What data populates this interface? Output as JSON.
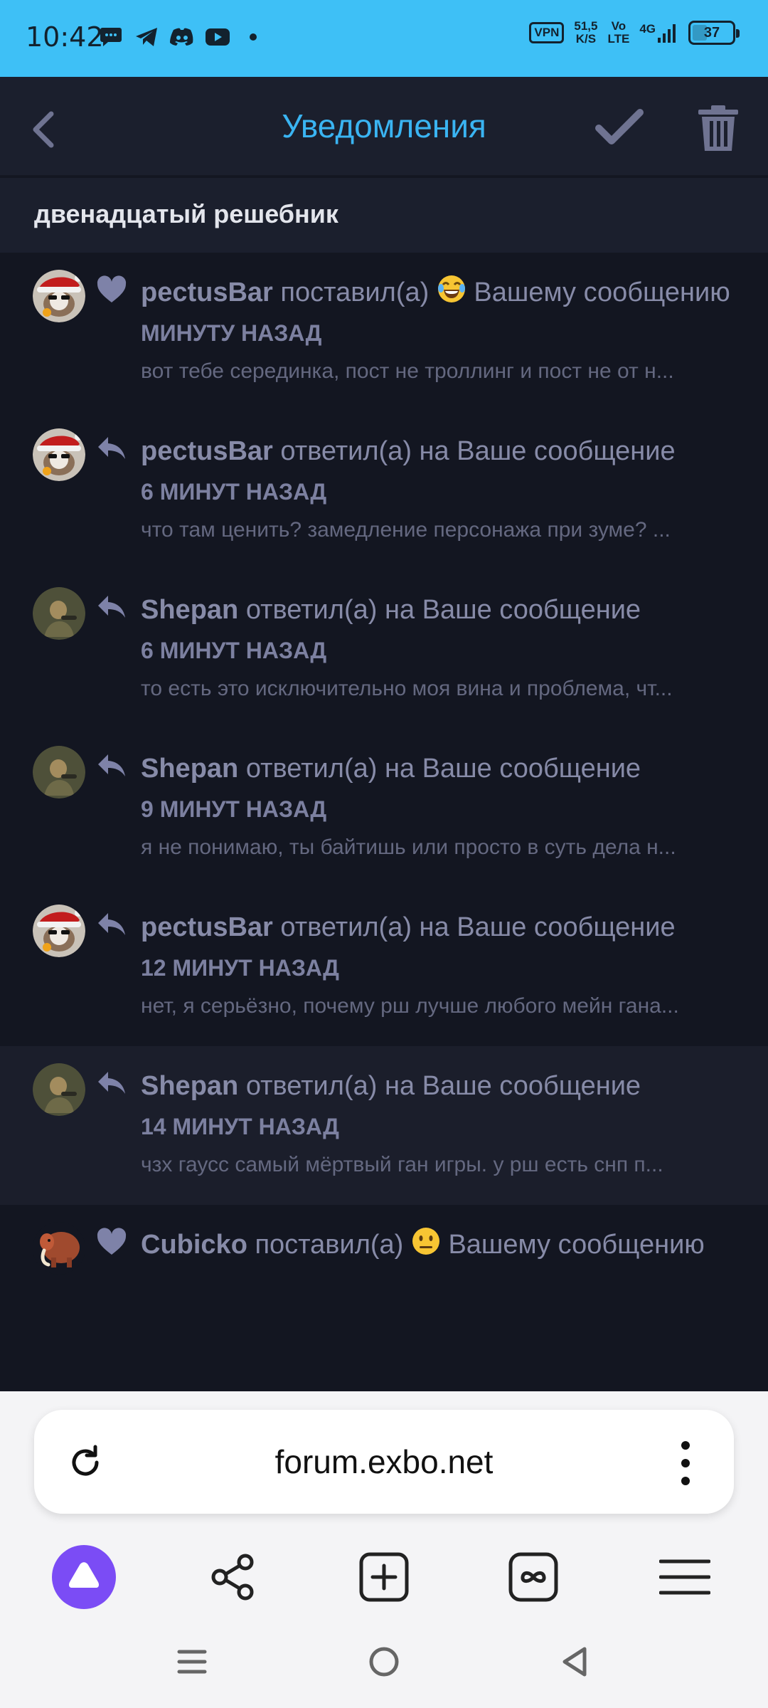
{
  "status_bar": {
    "time": "10:42",
    "vpn": "VPN",
    "net_speed_top": "51,5",
    "net_speed_bottom": "K/S",
    "volte_top": "Vo",
    "volte_bottom": "LTE",
    "network": "4G",
    "battery": "37",
    "icons": [
      "chat-bubble-icon",
      "telegram-icon",
      "discord-icon",
      "youtube-icon",
      "dot-icon"
    ]
  },
  "header": {
    "title": "Уведомления",
    "back_icon": "chevron-left-icon",
    "mark_read_icon": "checkmark-icon",
    "delete_icon": "trash-icon",
    "accent": "#3ab4f2"
  },
  "section": {
    "title": "двенадцатый решебник"
  },
  "notifications": [
    {
      "user": "pectusBar",
      "action": "поставил(а)",
      "emoji": "😂",
      "rest": "Вашему сообщению",
      "time": "МИНУТУ НАЗАД",
      "excerpt": "вот тебе серединка, пост не троллинг и пост не от н...",
      "type_icon": "heart-icon",
      "avatar": "santa-hat-avatar"
    },
    {
      "user": "pectusBar",
      "action": "ответил(а) на Ваше сообщение",
      "time": "6 МИНУТ НАЗАД",
      "excerpt": "что там ценить? замедление персонажа при зуме? ...",
      "type_icon": "reply-icon",
      "avatar": "santa-hat-avatar"
    },
    {
      "user": "Shepan",
      "action": "ответил(а) на Ваше сообщение",
      "time": "6 МИНУТ НАЗАД",
      "excerpt": "то есть это исключительно моя вина и проблема, чт...",
      "type_icon": "reply-icon",
      "avatar": "soldier-avatar"
    },
    {
      "user": "Shepan",
      "action": "ответил(а) на Ваше сообщение",
      "time": "9 МИНУТ НАЗАД",
      "excerpt": "я не понимаю, ты байтишь или просто в суть дела н...",
      "type_icon": "reply-icon",
      "avatar": "soldier-avatar"
    },
    {
      "user": "pectusBar",
      "action": "ответил(а) на Ваше сообщение",
      "time": "12 МИНУТ НАЗАД",
      "excerpt": "нет, я серьёзно, почему рш лучше любого мейн гана...",
      "type_icon": "reply-icon",
      "avatar": "santa-hat-avatar"
    },
    {
      "user": "Shepan",
      "action": "ответил(а) на Ваше сообщение",
      "time": "14 МИНУТ НАЗАД",
      "excerpt": "чзх гаусс самый мёртвый ган игры. у рш есть снп п...",
      "type_icon": "reply-icon",
      "avatar": "soldier-avatar",
      "unread": true
    },
    {
      "user": "Cubicko",
      "action": "поставил(а)",
      "emoji": "😐",
      "rest": "Вашему сообщению",
      "time": "",
      "excerpt": "",
      "type_icon": "heart-icon",
      "avatar": "mammoth-avatar"
    }
  ],
  "browser": {
    "url": "forum.exbo.net",
    "reload_icon": "reload-icon",
    "menu_icon": "kebab-menu-icon",
    "nav": [
      "alice-assistant-icon",
      "share-icon",
      "new-tab-icon",
      "tabs-icon",
      "hamburger-menu-icon"
    ]
  },
  "system_nav": [
    "recents-icon",
    "home-icon",
    "back-triangle-icon"
  ]
}
